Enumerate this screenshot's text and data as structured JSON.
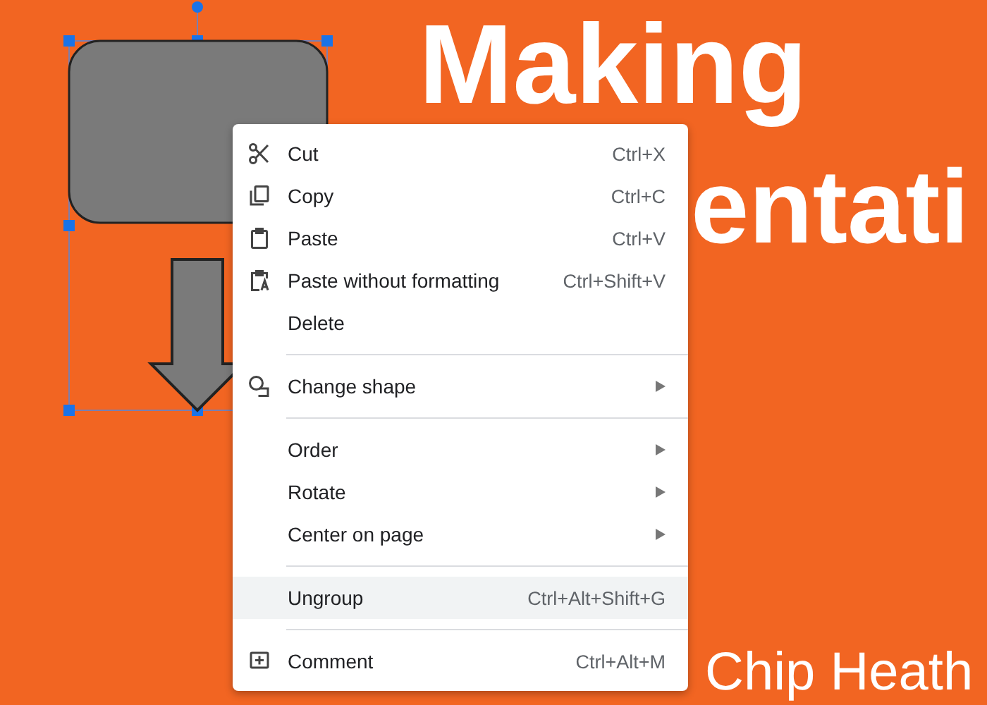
{
  "slide": {
    "title_line_1": "Making",
    "title_line_2": "entati",
    "byline": "Chip Heath"
  },
  "context_menu": {
    "groups": [
      [
        {
          "label": "Cut",
          "shortcut": "Ctrl+X",
          "submenu": false,
          "selected": false
        },
        {
          "label": "Copy",
          "shortcut": "Ctrl+C",
          "submenu": false,
          "selected": false
        },
        {
          "label": "Paste",
          "shortcut": "Ctrl+V",
          "submenu": false,
          "selected": false
        },
        {
          "label": "Paste without formatting",
          "shortcut": "Ctrl+Shift+V",
          "submenu": false,
          "selected": false
        },
        {
          "label": "Delete",
          "submenu": false,
          "selected": false
        }
      ],
      [
        {
          "label": "Change shape",
          "submenu": true,
          "selected": false
        }
      ],
      [
        {
          "label": "Order",
          "submenu": true,
          "selected": false
        },
        {
          "label": "Rotate",
          "submenu": true,
          "selected": false
        },
        {
          "label": "Center on page",
          "submenu": true,
          "selected": false
        }
      ],
      [
        {
          "label": "Ungroup",
          "shortcut": "Ctrl+Alt+Shift+G",
          "submenu": false,
          "selected": true
        }
      ],
      [
        {
          "label": "Comment",
          "shortcut": "Ctrl+Alt+M",
          "submenu": false,
          "selected": false
        }
      ]
    ]
  }
}
